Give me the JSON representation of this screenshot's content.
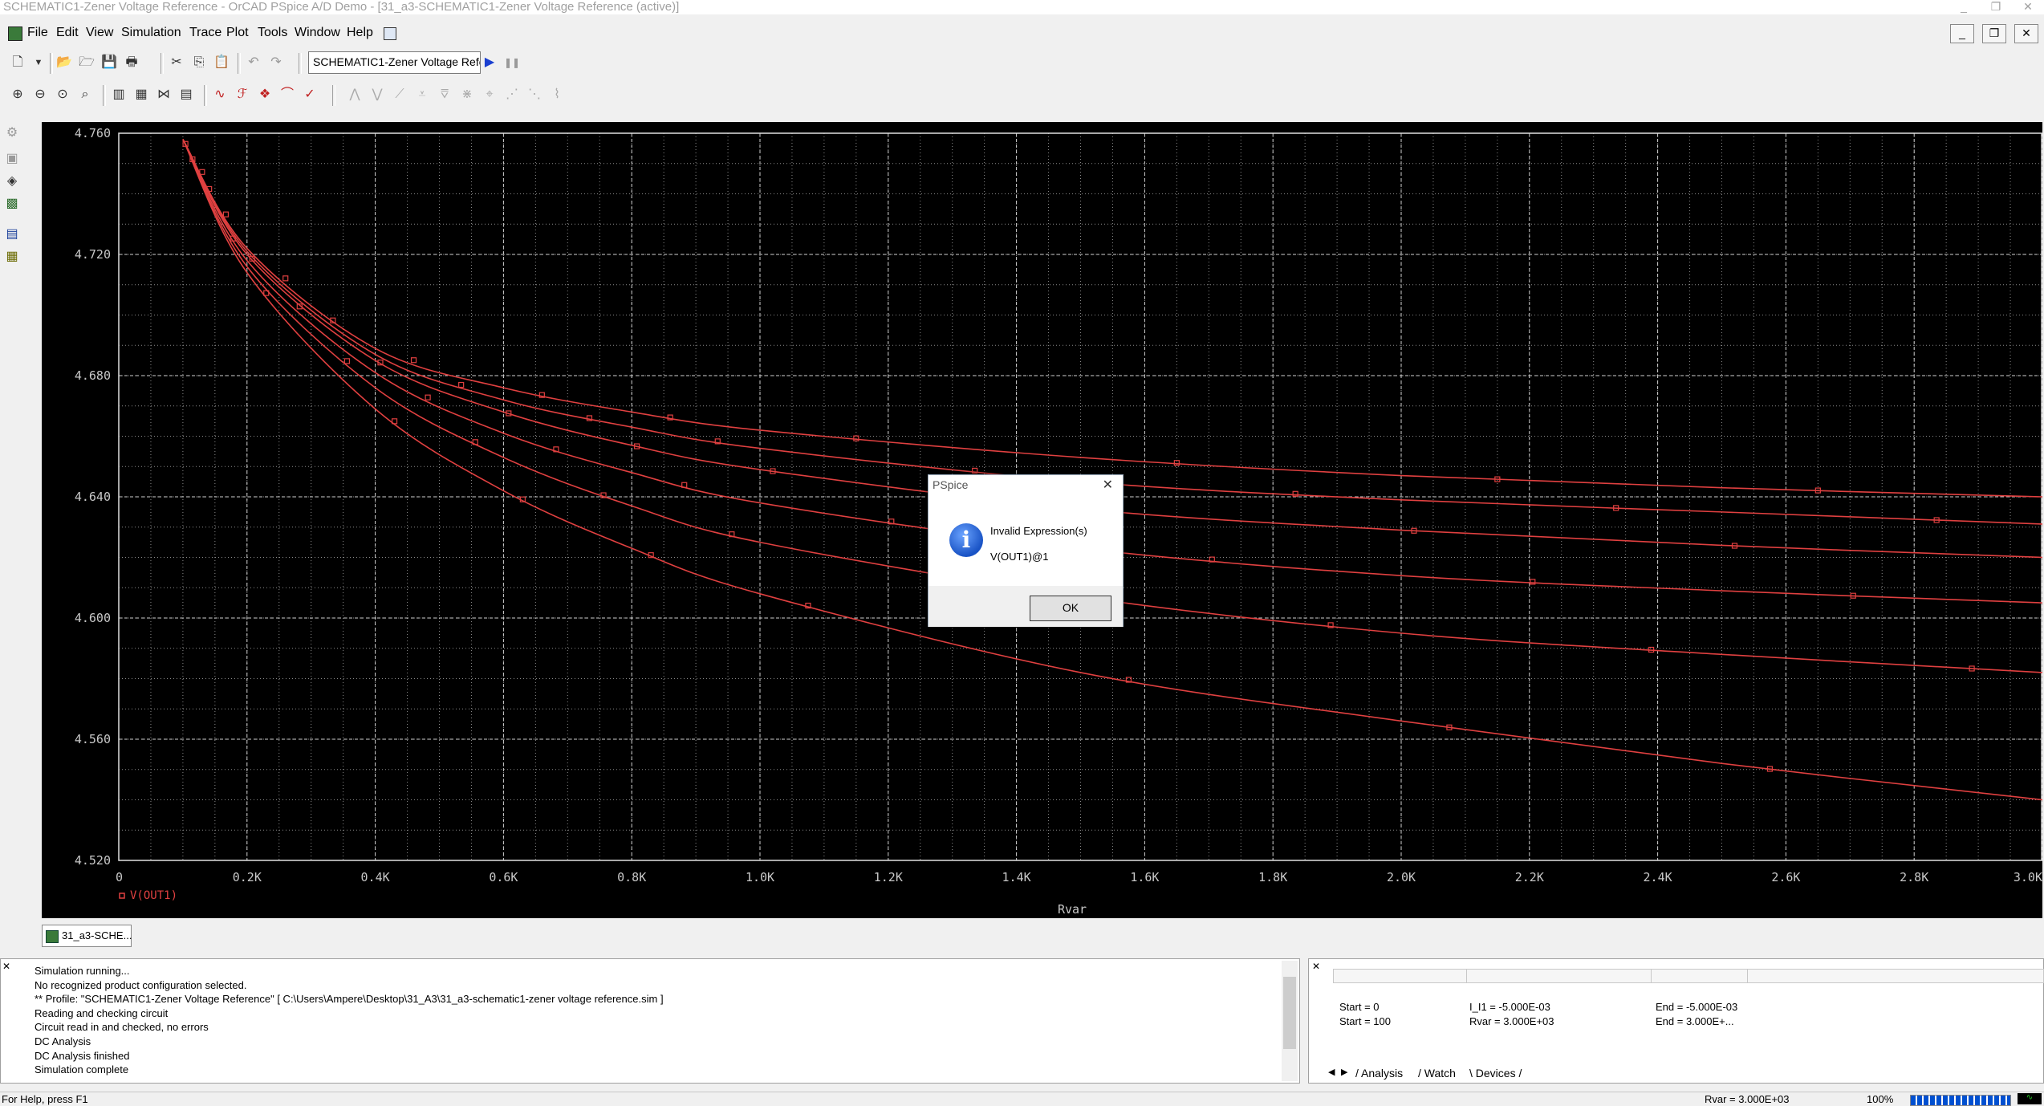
{
  "window": {
    "title": "SCHEMATIC1-Zener Voltage Reference - OrCAD PSpice A/D Demo  - [31_a3-SCHEMATIC1-Zener Voltage Reference (active)]",
    "minimize": "_",
    "restore": "❐",
    "close": "✕"
  },
  "menu": {
    "file": "File",
    "edit": "Edit",
    "view": "View",
    "simulation": "Simulation",
    "trace": "Trace",
    "plot": "Plot",
    "tools": "Tools",
    "window": "Window",
    "help": "Help",
    "mdi_minimize": "_",
    "mdi_restore": "❐",
    "mdi_close": "✕"
  },
  "toolbar": {
    "profile": "SCHEMATIC1-Zener Voltage Refe",
    "run": "▶",
    "pause": "❚❚"
  },
  "icons": {
    "new": "new-icon",
    "open": "open-icon",
    "save": "save-icon",
    "print": "print-icon",
    "cut": "cut-icon",
    "copy": "copy-icon",
    "paste": "paste-icon",
    "undo": "undo-icon",
    "redo": "redo-icon",
    "zoom_in": "zoom-in-icon",
    "zoom_out": "zoom-out-icon",
    "zoom_area": "zoom-area-icon",
    "zoom_fit": "zoom-fit-icon"
  },
  "chart_data": {
    "type": "line",
    "x_ticks": [
      "0",
      "0.2K",
      "0.4K",
      "0.6K",
      "0.8K",
      "1.0K",
      "1.2K",
      "1.4K",
      "1.6K",
      "1.8K",
      "2.0K",
      "2.2K",
      "2.4K",
      "2.6K",
      "2.8K",
      "3.0K"
    ],
    "y_ticks": [
      "4.760",
      "4.720",
      "4.680",
      "4.640",
      "4.600",
      "4.560",
      "4.520"
    ],
    "xlabel": "Rvar",
    "xlim": [
      0,
      3000
    ],
    "ylim": [
      4.52,
      4.76
    ],
    "legend": "V(OUT1)",
    "series_color": "#e04040",
    "series": [
      {
        "x": [
          100,
          200,
          400,
          600,
          800,
          1000,
          1500,
          2000,
          2500,
          3000
        ],
        "values": [
          4.758,
          4.722,
          4.689,
          4.676,
          4.668,
          4.662,
          4.653,
          4.647,
          4.643,
          4.64
        ]
      },
      {
        "x": [
          100,
          200,
          400,
          600,
          800,
          1000,
          1500,
          2000,
          2500,
          3000
        ],
        "values": [
          4.758,
          4.721,
          4.687,
          4.672,
          4.663,
          4.656,
          4.645,
          4.639,
          4.635,
          4.631
        ]
      },
      {
        "x": [
          100,
          200,
          400,
          600,
          800,
          1000,
          1500,
          2000,
          2500,
          3000
        ],
        "values": [
          4.758,
          4.72,
          4.685,
          4.668,
          4.657,
          4.649,
          4.636,
          4.629,
          4.624,
          4.62
        ]
      },
      {
        "x": [
          100,
          200,
          400,
          600,
          800,
          1000,
          1500,
          2000,
          2500,
          3000
        ],
        "values": [
          4.758,
          4.718,
          4.681,
          4.661,
          4.648,
          4.638,
          4.623,
          4.614,
          4.609,
          4.605
        ]
      },
      {
        "x": [
          100,
          200,
          400,
          600,
          800,
          1000,
          1500,
          2000,
          2500,
          3000
        ],
        "values": [
          4.758,
          4.716,
          4.676,
          4.653,
          4.637,
          4.625,
          4.607,
          4.595,
          4.588,
          4.582
        ]
      },
      {
        "x": [
          100,
          200,
          400,
          600,
          800,
          1000,
          1500,
          2000,
          2500,
          3000
        ],
        "values": [
          4.758,
          4.714,
          4.669,
          4.642,
          4.623,
          4.608,
          4.582,
          4.566,
          4.552,
          4.54
        ]
      }
    ]
  },
  "doc_tab": "31_a3-SCHE...",
  "output": {
    "lines": [
      "Simulation running...",
      "No recognized product configuration selected.",
      "** Profile: \"SCHEMATIC1-Zener Voltage Reference\"  [ C:\\Users\\Ampere\\Desktop\\31_A3\\31_a3-schematic1-zener voltage reference.sim ]",
      "Reading and checking circuit",
      "Circuit read in and checked, no errors",
      "DC Analysis",
      "DC Analysis finished",
      "Simulation complete"
    ]
  },
  "sim_status": {
    "row1": {
      "start": "Start =  0",
      "param": "I_I1 =  -5.000E-03",
      "end": "End = -5.000E-03"
    },
    "row2": {
      "start": "Start = 100",
      "param": "Rvar =  3.000E+03",
      "end": "End =  3.000E+..."
    },
    "tabs": [
      "Analysis",
      "Watch",
      "Devices"
    ]
  },
  "statusbar": {
    "help": "For Help, press F1",
    "rvar": "Rvar =  3.000E+03",
    "zoom": "100%"
  },
  "dialog": {
    "title": "PSpice",
    "close": "✕",
    "icon": "information-icon",
    "message": "Invalid Expression(s)",
    "detail": "V(OUT1)@1",
    "ok": "OK"
  }
}
